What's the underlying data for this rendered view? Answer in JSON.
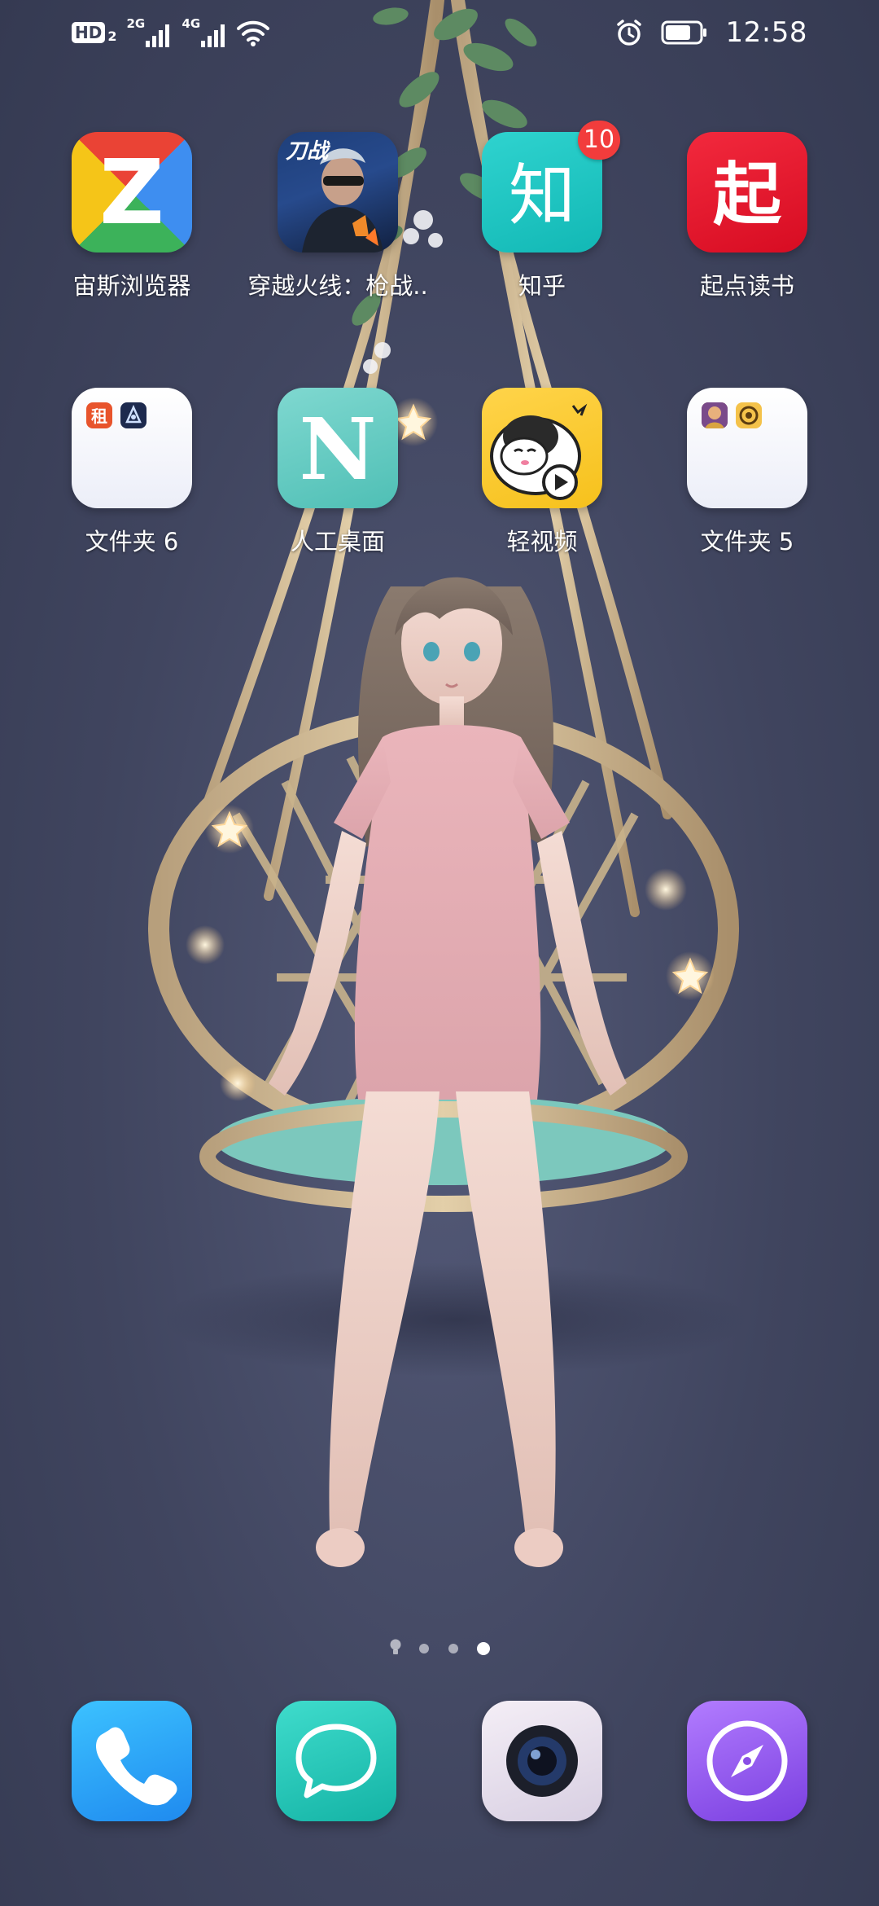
{
  "status_bar": {
    "hd_label": "HD",
    "hd_sim": "2",
    "sim1_network": "2G",
    "sim2_network": "4G",
    "wifi_icon": "wifi-icon",
    "alarm_icon": "alarm-icon",
    "battery_icon": "battery-icon",
    "battery_level": 0.75,
    "time": "12:58"
  },
  "apps_row1": [
    {
      "label": "宙斯浏览器",
      "icon": "zeus-browser-icon",
      "glyph": "Z"
    },
    {
      "label": "穿越火线：枪战..",
      "icon": "crossfire-game-icon",
      "glyph": "刀战"
    },
    {
      "label": "知乎",
      "icon": "zhihu-icon",
      "glyph": "知",
      "badge": "10"
    },
    {
      "label": "起点读书",
      "icon": "qidian-icon",
      "glyph": "起"
    }
  ],
  "apps_row2": [
    {
      "label": "文件夹 6",
      "icon": "folder-icon",
      "mini_glyph": "租"
    },
    {
      "label": "人工桌面",
      "icon": "artificial-desktop-icon",
      "glyph": "N"
    },
    {
      "label": "轻视频",
      "icon": "light-video-icon"
    },
    {
      "label": "文件夹 5",
      "icon": "folder-icon"
    }
  ],
  "page_indicator": {
    "pages": 4,
    "current": 4,
    "first_icon": "lightbulb-icon"
  },
  "dock": [
    {
      "name": "phone",
      "icon": "phone-icon"
    },
    {
      "name": "messages",
      "icon": "message-icon"
    },
    {
      "name": "camera",
      "icon": "camera-icon"
    },
    {
      "name": "browser",
      "icon": "compass-icon"
    }
  ],
  "colors": {
    "background": "#40455f",
    "badge": "#f23c3c",
    "zhihu": "#1fc3c0",
    "qidian": "#e5132a",
    "phone": "#2b9bf5",
    "messages": "#24c7b9",
    "browser": "#8a4fe6"
  }
}
